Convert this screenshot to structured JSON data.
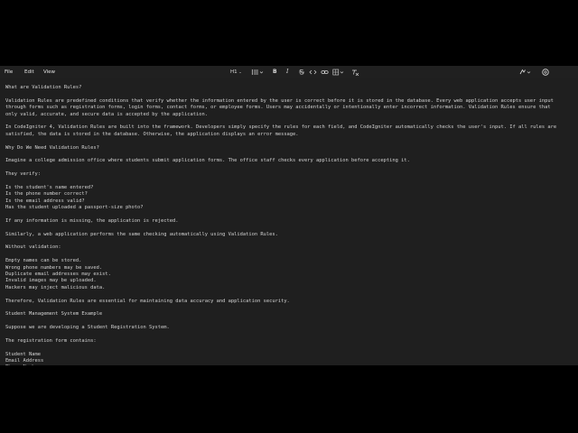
{
  "menubar": {
    "items": [
      "File",
      "Edit",
      "View"
    ],
    "heading_label": "H1"
  },
  "document": {
    "lines": [
      "What are Validation Rules?",
      "",
      "Validation Rules are predefined conditions that verify whether the information entered by the user is correct before it is stored in the database. Every web application accepts user input",
      "through forms such as registration forms, login forms, contact forms, or employee forms. Users may accidentally or intentionally enter incorrect information. Validation Rules ensure that",
      "only valid, accurate, and secure data is accepted by the application.",
      "",
      "In CodeIgniter 4, Validation Rules are built into the framework. Developers simply specify the rules for each field, and CodeIgniter automatically checks the user's input. If all rules are",
      "satisfied, the data is stored in the database. Otherwise, the application displays an error message.",
      "",
      "Why Do We Need Validation Rules?",
      "",
      "Imagine a college admission office where students submit application forms. The office staff checks every application before accepting it.",
      "",
      "They verify:",
      "",
      "Is the student's name entered?",
      "Is the phone number correct?",
      "Is the email address valid?",
      "Has the student uploaded a passport-size photo?",
      "",
      "If any information is missing, the application is rejected.",
      "",
      "Similarly, a web application performs the same checking automatically using Validation Rules.",
      "",
      "Without validation:",
      "",
      "Empty names can be stored.",
      "Wrong phone numbers may be saved.",
      "Duplicate email addresses may exist.",
      "Invalid images may be uploaded.",
      "Hackers may inject malicious data.",
      "",
      "Therefore, Validation Rules are essential for maintaining data accuracy and application security.",
      "",
      "Student Management System Example",
      "",
      "Suppose we are developing a Student Registration System.",
      "",
      "The registration form contains:",
      "",
      "Student Name",
      "Email Address",
      "Phone Number"
    ]
  },
  "icons": {
    "list": "list-icon",
    "bold": "bold-icon",
    "italic": "italic-icon",
    "strikethrough": "strikethrough-icon",
    "code": "code-icon",
    "link": "link-icon",
    "table": "table-icon",
    "clear_format": "clear-format-icon",
    "copilot": "copilot-icon",
    "settings": "settings-icon"
  }
}
